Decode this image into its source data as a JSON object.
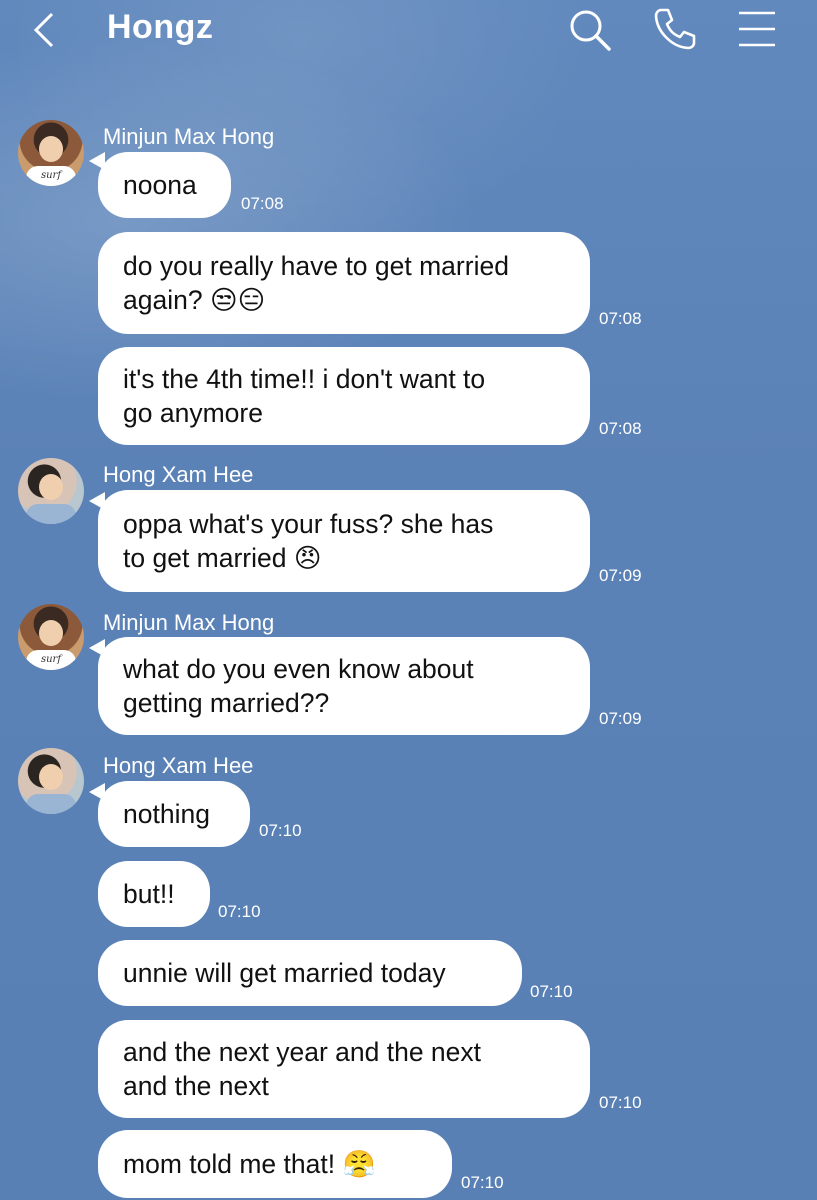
{
  "header": {
    "title": "Hongz",
    "icons": [
      "back-chevron-icon",
      "search-icon",
      "phone-icon",
      "menu-icon"
    ]
  },
  "messages": [
    {
      "sender": "Minjun Max Hong",
      "text": "noona",
      "time": "07:08"
    },
    {
      "text_lines": [
        "do you really have to get married",
        "again? 😒😑"
      ],
      "time": "07:08"
    },
    {
      "text_lines": [
        "it's the 4th time!! i don't want to",
        "go anymore"
      ],
      "time": "07:08"
    },
    {
      "sender": "Hong Xam Hee",
      "text_lines": [
        "oppa what's your fuss? she has",
        "to get married 😠"
      ],
      "time": "07:09"
    },
    {
      "sender": "Minjun Max Hong",
      "text_lines": [
        "what do you even know about",
        "getting married??"
      ],
      "time": "07:09"
    },
    {
      "sender": "Hong Xam Hee",
      "text": "nothing",
      "time": "07:10"
    },
    {
      "text": "but!!",
      "time": "07:10"
    },
    {
      "text": "unnie will get married today",
      "time": "07:10"
    },
    {
      "text_lines": [
        "and the next year and the next",
        "and the next"
      ],
      "time": "07:10"
    },
    {
      "text": "mom told me that! 😤",
      "time": "07:10"
    }
  ],
  "avatars": {
    "max_shirt_text": "surf"
  }
}
